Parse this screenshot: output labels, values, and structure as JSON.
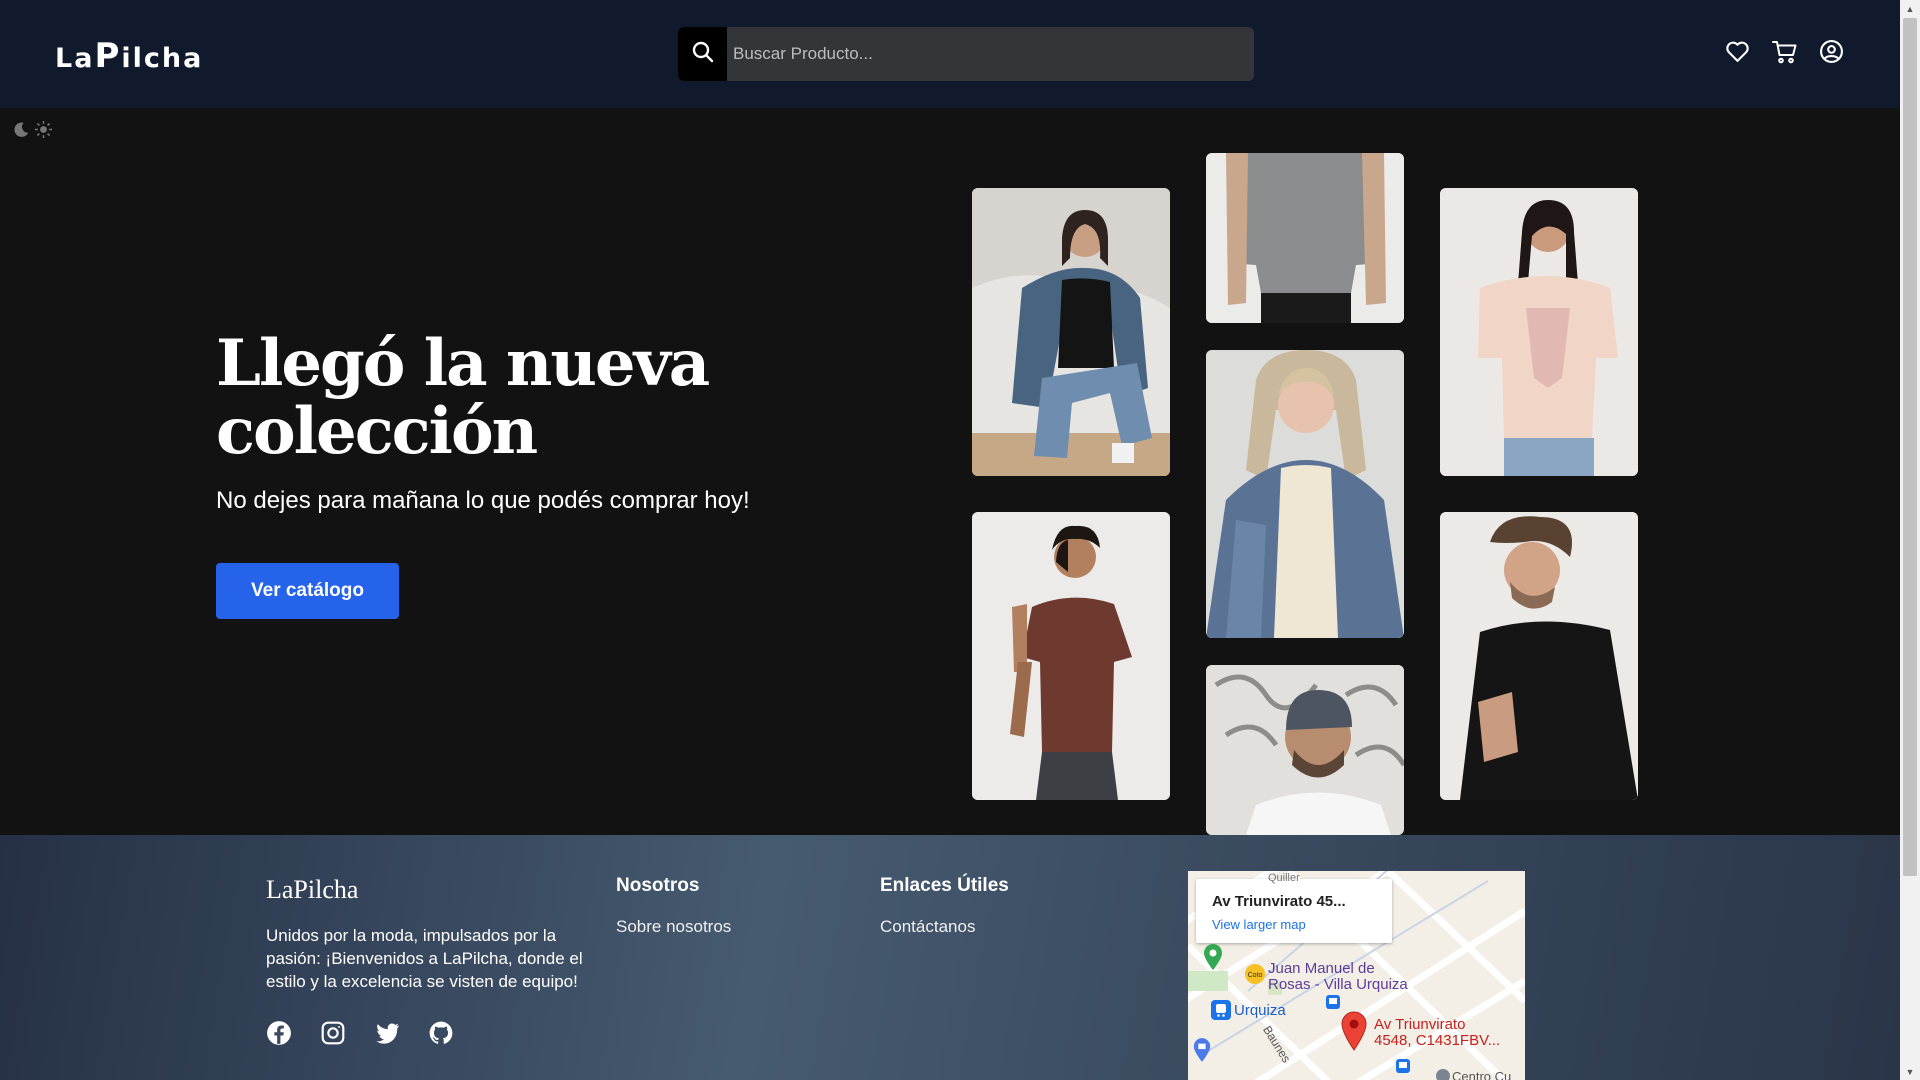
{
  "header": {
    "logo_prefix": "La",
    "logo_big": "P",
    "logo_suffix": "ilcha",
    "search_placeholder": "Buscar Producto...",
    "icons": [
      "heart-icon",
      "cart-icon",
      "user-circle-icon"
    ]
  },
  "theme_toggle": {
    "icons": [
      "moon-icon",
      "sun-icon"
    ]
  },
  "hero": {
    "title": "Llegó la nueva colección",
    "subtitle": "No dejes para mañana lo que podés comprar hoy!",
    "cta_label": "Ver catálogo",
    "cta_color": "#2563eb"
  },
  "footer": {
    "brand": "LaPilcha",
    "description": "Unidos por la moda, impulsados por la pasión: ¡Bienvenidos a LaPilcha, donde el estilo y la excelencia se visten de equipo!",
    "social_icons": [
      "facebook-icon",
      "instagram-icon",
      "twitter-icon",
      "github-icon"
    ],
    "col1_title": "Nosotros",
    "col1_link": "Sobre nosotros",
    "col2_title": "Enlaces Útiles",
    "col2_link": "Contáctanos"
  },
  "map": {
    "card_title": "Av Triunvirato 45...",
    "card_link": "View larger map",
    "place1_line1": "Juan Manuel de",
    "place1_line2": "Rosas - Villa Urquiza",
    "station": "Urquiza",
    "pin_line1": "Av Triunvirato",
    "pin_line2": "4548, C1431FBV...",
    "street": "Baunes",
    "street_top": "Quiller",
    "bottom_label": "Centro Cu"
  },
  "colors": {
    "header_bg": "#111a2c",
    "page_bg": "#121212",
    "accent": "#2563eb"
  }
}
